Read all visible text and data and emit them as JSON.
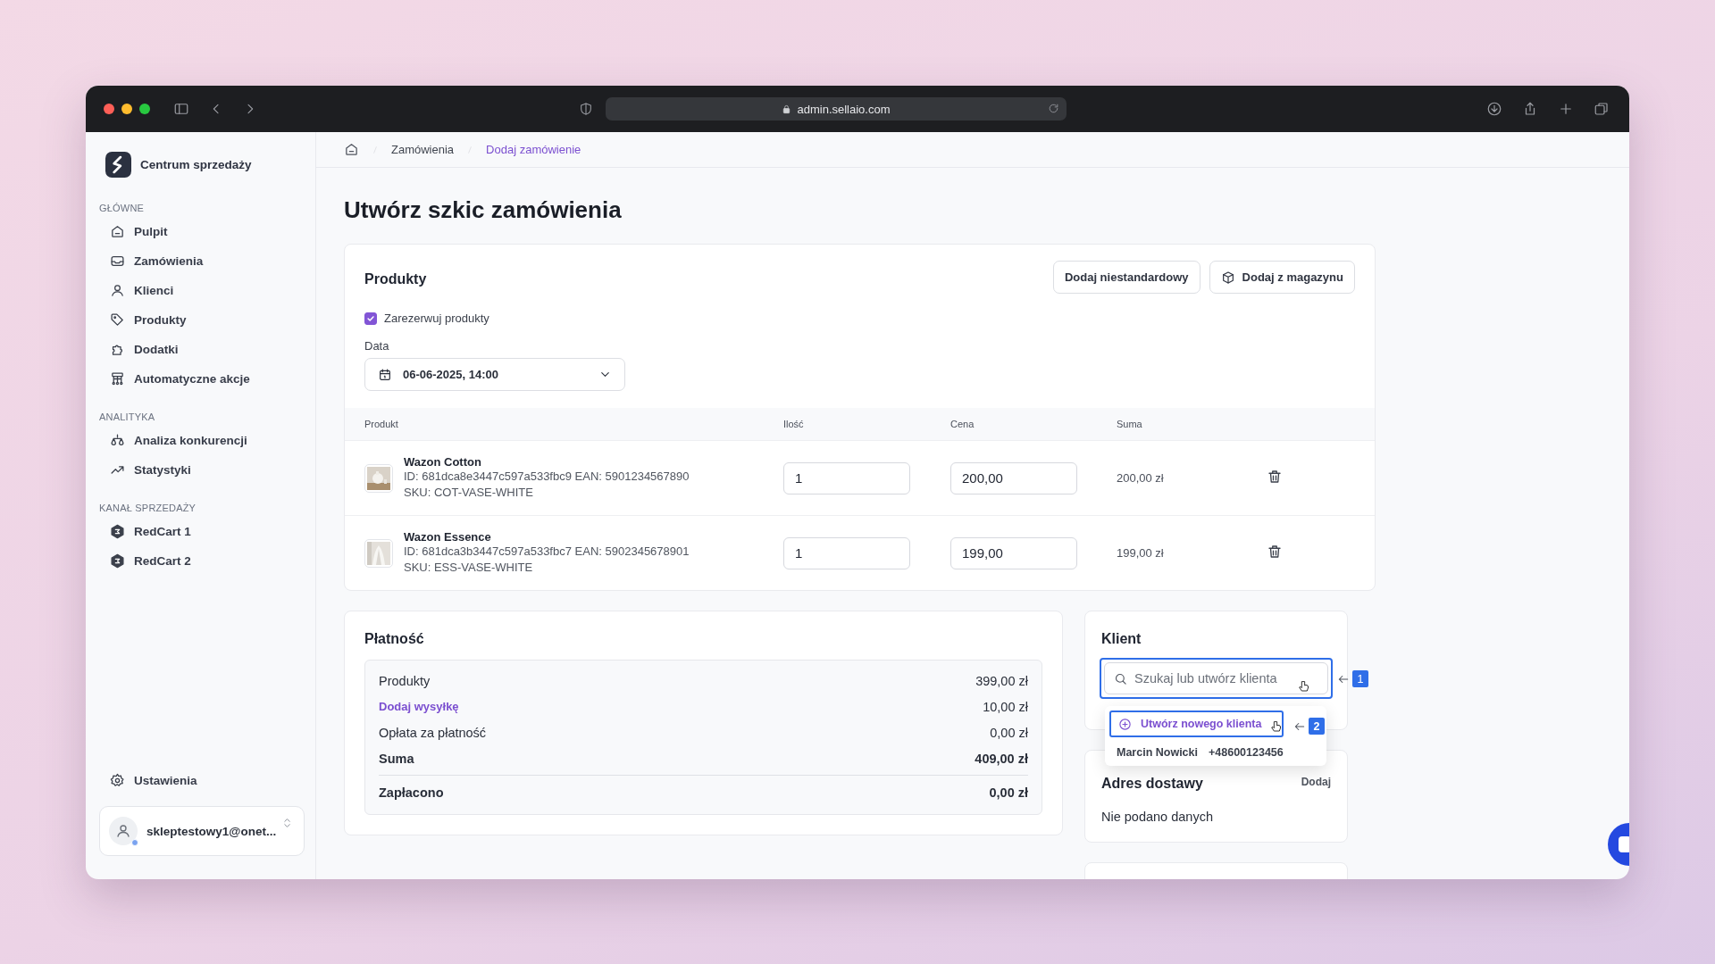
{
  "browser": {
    "url": "admin.sellaio.com"
  },
  "sidebar": {
    "brand": "Centrum sprzedaży",
    "sections": [
      {
        "title": "GŁÓWNE",
        "items": [
          {
            "label": "Pulpit"
          },
          {
            "label": "Zamówienia"
          },
          {
            "label": "Klienci"
          },
          {
            "label": "Produkty"
          },
          {
            "label": "Dodatki"
          },
          {
            "label": "Automatyczne akcje"
          }
        ]
      },
      {
        "title": "ANALITYKA",
        "items": [
          {
            "label": "Analiza konkurencji"
          },
          {
            "label": "Statystyki"
          }
        ]
      },
      {
        "title": "KANAŁ SPRZEDAŻY",
        "items": [
          {
            "label": "RedCart 1"
          },
          {
            "label": "RedCart 2"
          }
        ]
      }
    ],
    "settings": "Ustawienia",
    "account": "skleptestowy1@onet..."
  },
  "breadcrumb": [
    {
      "label": "Zamówienia",
      "selected": false
    },
    {
      "label": "Dodaj zamówienie",
      "selected": true
    }
  ],
  "page_title": "Utwórz szkic zamówienia",
  "products": {
    "title": "Produkty",
    "buttons": [
      {
        "label": "Dodaj niestandardowy",
        "kind": "plain"
      },
      {
        "label": "Dodaj z magazynu",
        "kind": "box"
      }
    ],
    "reserve": {
      "label": "Zarezerwuj produkty",
      "checked": true
    },
    "date": {
      "label": "Data",
      "value": "06-06-2025, 14:00"
    },
    "columns": [
      "Produkt",
      "Ilość",
      "Cena",
      "Suma"
    ],
    "rows": [
      {
        "name": "Wazon Cotton",
        "ids": "ID: 681dca8e3447c597a533fbc9 EAN: 5901234567890",
        "sku": "SKU: COT-VASE-WHITE",
        "qty": "1",
        "price": "200,00",
        "total": "200,00 zł"
      },
      {
        "name": "Wazon Essence",
        "ids": "ID: 681dca3b3447c597a533fbc7 EAN: 5902345678901",
        "sku": "SKU: ESS-VASE-WHITE",
        "qty": "1",
        "price": "199,00",
        "total": "199,00 zł"
      }
    ]
  },
  "payment": {
    "title": "Płatność",
    "lines": [
      {
        "label": "Produkty",
        "value": "399,00 zł",
        "kind": "normal"
      },
      {
        "label": "Dodaj wysyłkę",
        "value": "10,00 zł",
        "kind": "link"
      },
      {
        "label": "Opłata za płatność",
        "value": "0,00 zł",
        "kind": "normal"
      },
      {
        "label": "Suma",
        "value": "409,00 zł",
        "kind": "bold"
      },
      {
        "label": "Zapłacono",
        "value": "0,00 zł",
        "kind": "total"
      }
    ]
  },
  "client": {
    "title": "Klient",
    "placeholder": "Szukaj lub utwórz klienta",
    "create": "Utwórz nowego klienta",
    "option": {
      "name": "Marcin Nowicki",
      "phone": "+48600123456"
    },
    "markers": [
      "1",
      "2"
    ]
  },
  "delivery": {
    "title": "Adres dostawy",
    "action": "Dodaj",
    "empty": "Nie podano danych"
  }
}
